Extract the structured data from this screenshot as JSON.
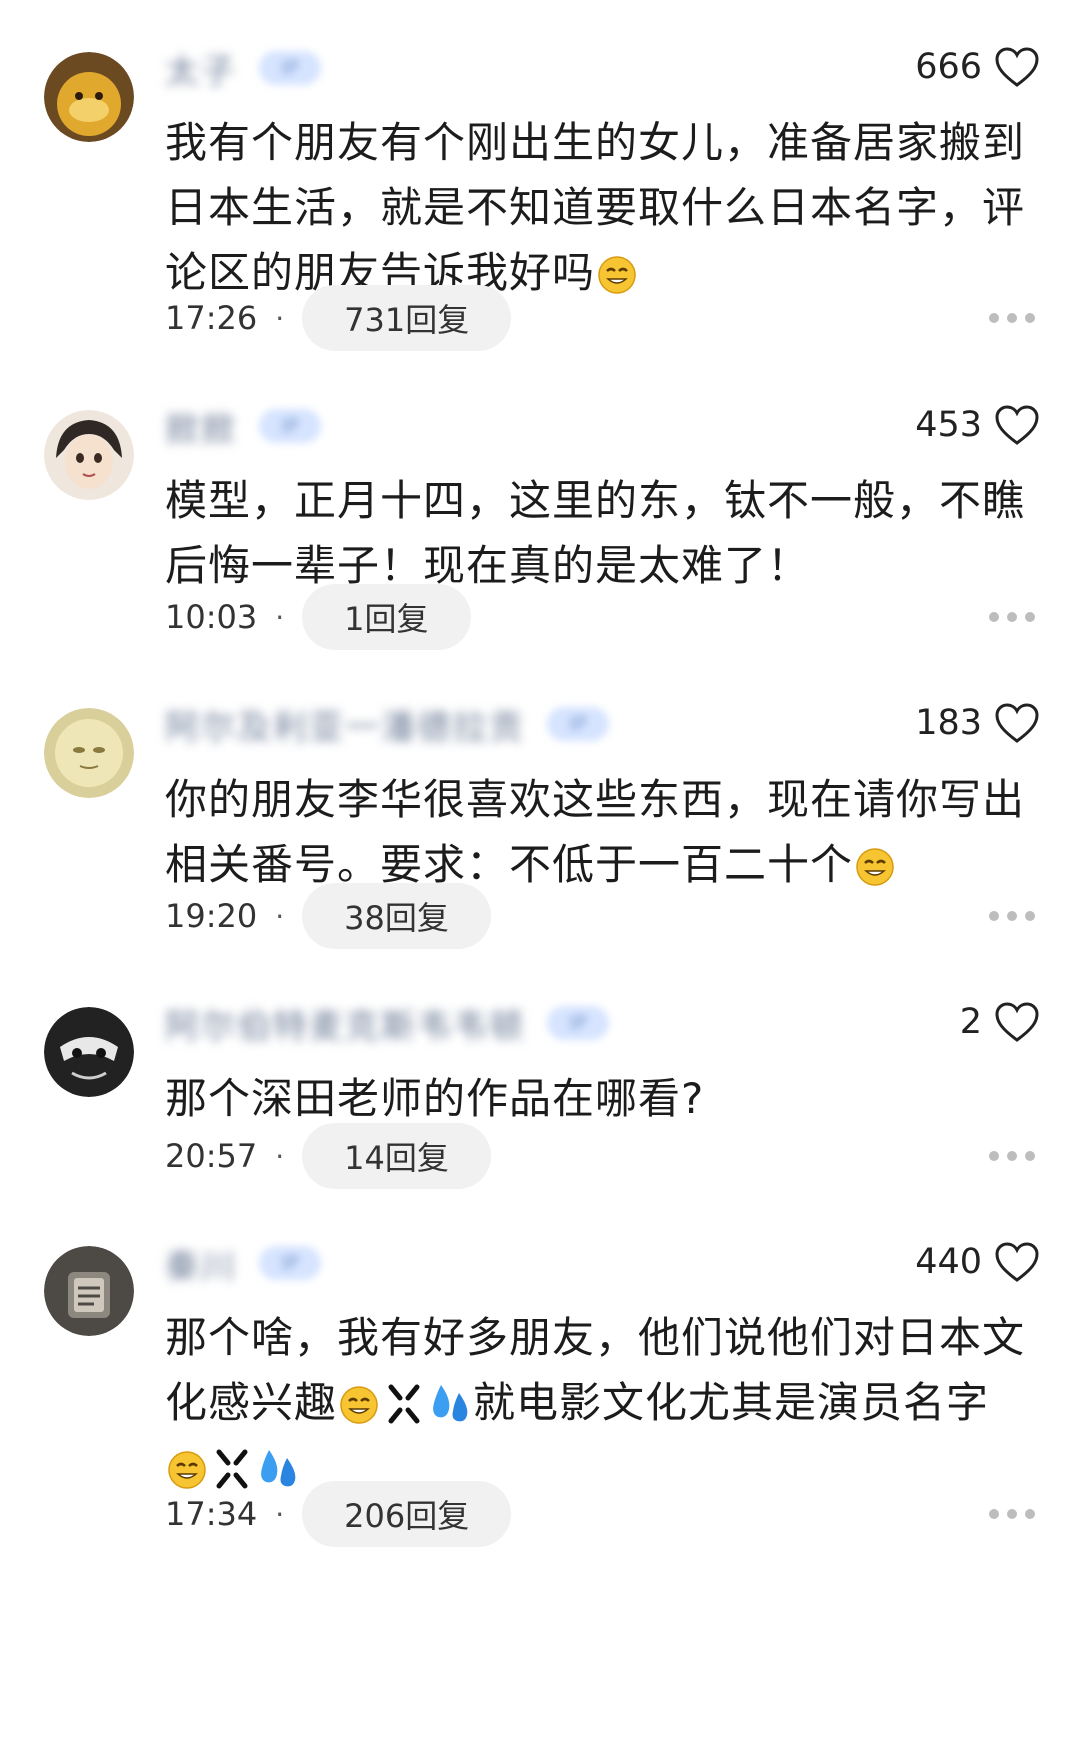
{
  "comments": [
    {
      "username": "太子",
      "ip_badge": "IP",
      "likes": "666",
      "text_parts": [
        "我有个朋友有个刚出生的女儿，准备居家搬到日本生活，就是不知道要取什么日本名字，评论区的朋友告诉我好吗"
      ],
      "time": "17:26",
      "replies": "731回复",
      "avatar_color": "#c9962a"
    },
    {
      "username": "掀掀",
      "ip_badge": "IP",
      "likes": "453",
      "text_parts": [
        "模型，正月十四，这里的东，钛不一般，不瞧后悔一辈子！现在真的是太难了！"
      ],
      "time": "10:03",
      "replies": "1回复",
      "avatar_color": "#d8c8bb"
    },
    {
      "username": "阿尔及利亚一潘德拉贡",
      "ip_badge": "IP",
      "likes": "183",
      "text_parts": [
        "你的朋友李华很喜欢这些东西，现在请你写出相关番号。要求：不低于一百二十个"
      ],
      "time": "19:20",
      "replies": "38回复",
      "avatar_color": "#e3d79a"
    },
    {
      "username": "阿尔伯特麦克斯韦韦顿",
      "ip_badge": "IP",
      "likes": "2",
      "text_parts": [
        "那个深田老师的作品在哪看?"
      ],
      "time": "20:57",
      "replies": "14回复",
      "avatar_color": "#2a2a2a"
    },
    {
      "username": "秦川",
      "ip_badge": "IP",
      "likes": "440",
      "text_parts": [
        "那个啥，我有好多朋友，他们说他们对日本文化感兴趣",
        "就电影文化尤其是演员名字"
      ],
      "time": "17:34",
      "replies": "206回复",
      "avatar_color": "#5d5a55"
    }
  ],
  "separator": "·",
  "icons": {
    "heart": "heart-outline-icon",
    "more": "more-dots-icon",
    "emoji": "smile-emoji-icon"
  }
}
